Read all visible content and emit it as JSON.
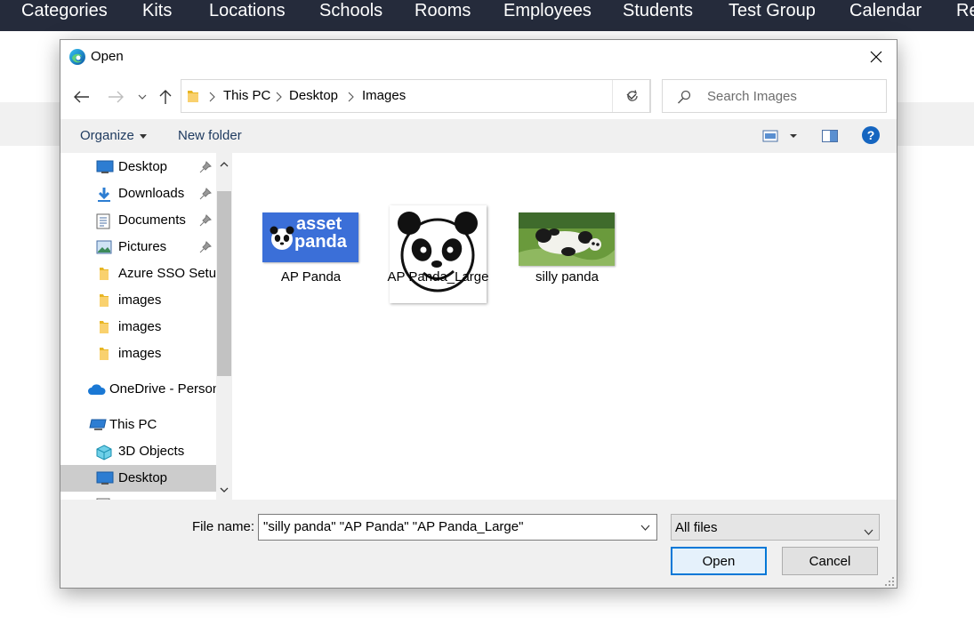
{
  "background_app": {
    "nav": [
      "Categories",
      "Kits",
      "Locations",
      "Schools",
      "Rooms",
      "Employees",
      "Students",
      "Test Group",
      "Calendar",
      "Re"
    ]
  },
  "dialog": {
    "title": "Open",
    "breadcrumbs": [
      "This PC",
      "Desktop",
      "Images"
    ],
    "search_placeholder": "Search Images",
    "toolbar": {
      "organize": "Organize",
      "new_folder": "New folder"
    },
    "nav_items": [
      {
        "label": "Desktop",
        "icon": "desktop-icon",
        "pinned": true
      },
      {
        "label": "Downloads",
        "icon": "downloads-icon",
        "pinned": true
      },
      {
        "label": "Documents",
        "icon": "documents-icon",
        "pinned": true
      },
      {
        "label": "Pictures",
        "icon": "pictures-icon",
        "pinned": true
      },
      {
        "label": "Azure SSO Setup",
        "icon": "folder-icon",
        "pinned": false
      },
      {
        "label": "images",
        "icon": "folder-icon",
        "pinned": false
      },
      {
        "label": "images",
        "icon": "folder-icon",
        "pinned": false
      },
      {
        "label": "images",
        "icon": "folder-icon",
        "pinned": false
      },
      {
        "label": "OneDrive - Person",
        "icon": "onedrive-icon",
        "pinned": false
      },
      {
        "label": "This PC",
        "icon": "this-pc-icon",
        "pinned": false
      },
      {
        "label": "3D Objects",
        "icon": "3d-objects-icon",
        "pinned": false
      },
      {
        "label": "Desktop",
        "icon": "desktop-icon",
        "pinned": false,
        "selected": true
      }
    ],
    "files": [
      {
        "name": "AP Panda",
        "thumb_text": [
          "asset",
          "panda"
        ]
      },
      {
        "name": "AP Panda_Large"
      },
      {
        "name": "silly panda"
      }
    ],
    "file_name_label": "File name:",
    "file_name_value": "\"silly panda\" \"AP Panda\" \"AP Panda_Large\"",
    "file_type": "All files",
    "open_label": "Open",
    "cancel_label": "Cancel",
    "colors": {
      "accent": "#0078d7",
      "brand_blue": "#3b6fd8",
      "nav_bg": "#252b3b"
    }
  }
}
